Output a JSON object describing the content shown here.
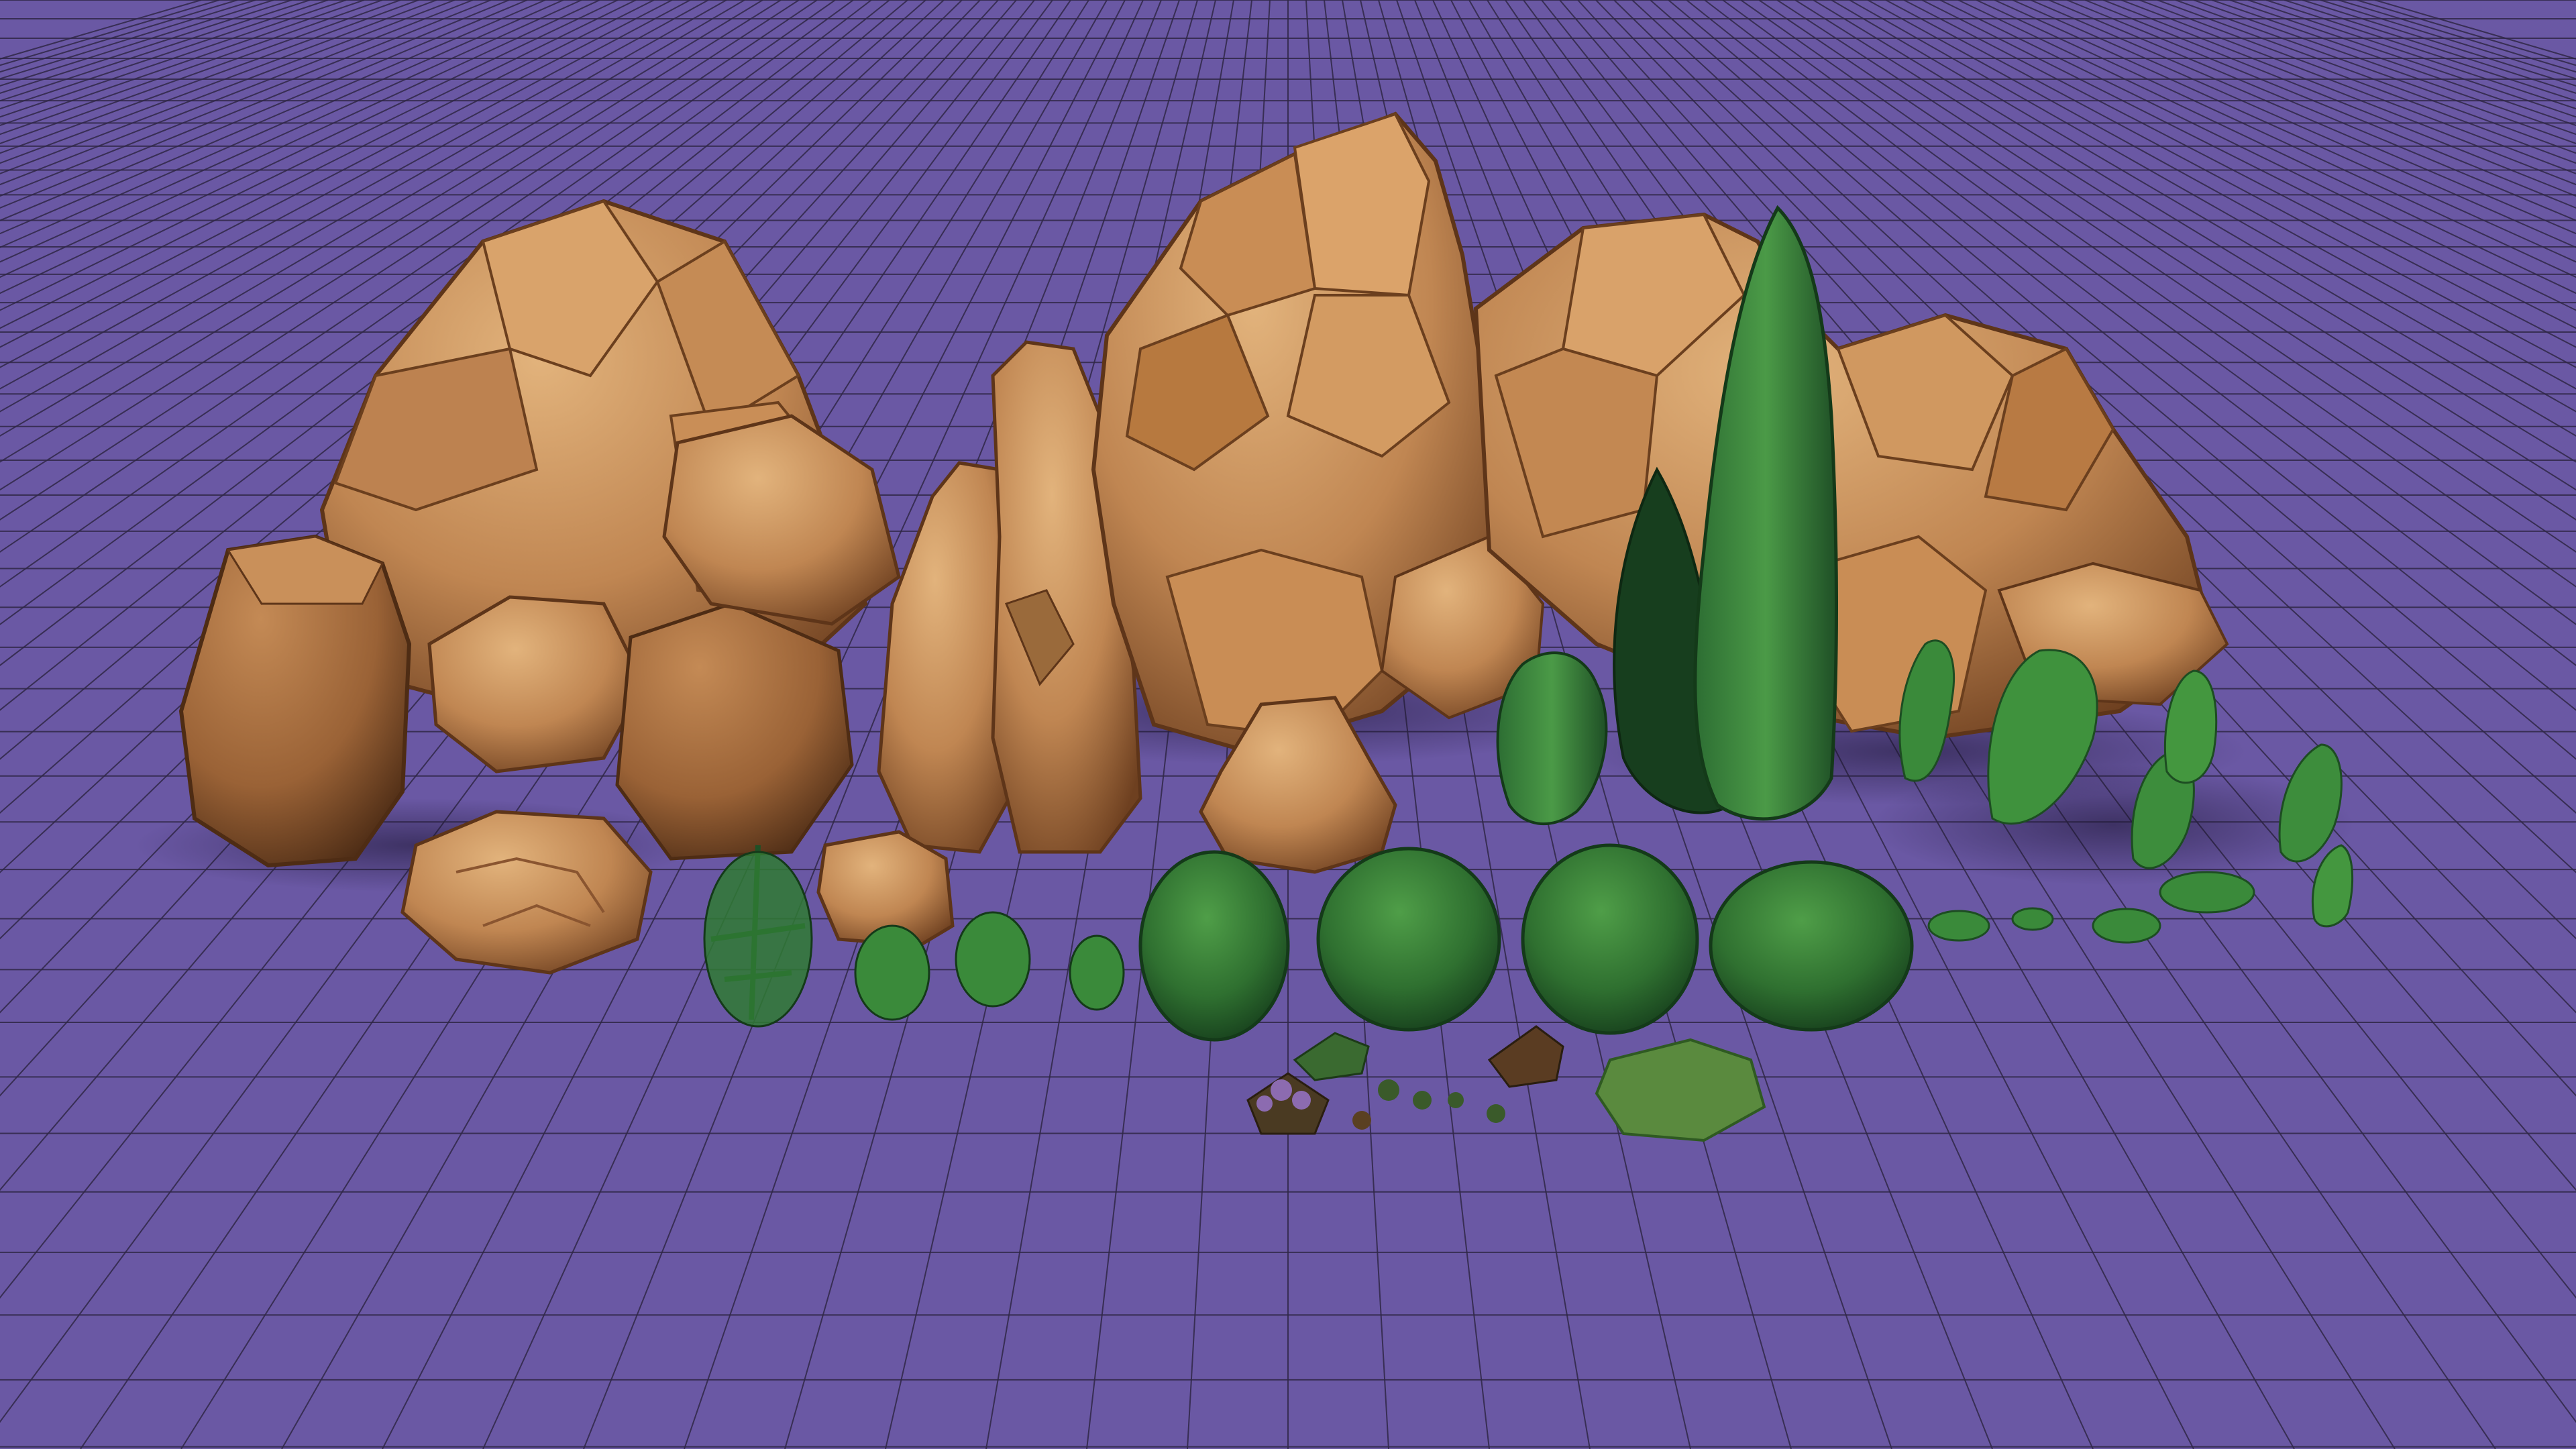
{
  "scene": {
    "kind": "3d-viewport-asset-showcase",
    "floor": {
      "color": "#6a58a4",
      "grid_line_color": "#2f2747",
      "grid": true
    },
    "palette": {
      "rock_light": "#d6a36c",
      "rock_mid": "#b67a45",
      "rock_dark": "#7c4b28",
      "rock_shadow": "#4a2c18",
      "foliage_light": "#4fa24c",
      "foliage_mid": "#2f7a34",
      "foliage_dark": "#194a22",
      "flower_purple": "#8c6bb0"
    },
    "assets": {
      "large_rocks": [
        {
          "id": "rock-cluster-left",
          "type": "rock-cluster"
        },
        {
          "id": "rock-cluster-center",
          "type": "rock-cluster"
        },
        {
          "id": "rock-cluster-right",
          "type": "rock-cluster"
        }
      ],
      "small_rocks": [
        {
          "id": "rock-pillar-left",
          "type": "rock"
        },
        {
          "id": "rock-pillar-center",
          "type": "rock"
        },
        {
          "id": "rock-flat-boulder",
          "type": "rock"
        },
        {
          "id": "rock-small-cube",
          "type": "rock"
        },
        {
          "id": "rock-small-mound",
          "type": "rock"
        }
      ],
      "trees": [
        {
          "id": "cypress-tall",
          "type": "tree"
        },
        {
          "id": "cypress-dark",
          "type": "tree"
        },
        {
          "id": "shrub-medium",
          "type": "shrub"
        }
      ],
      "bushes": [
        {
          "id": "bush-1",
          "type": "bush"
        },
        {
          "id": "bush-2",
          "type": "bush"
        },
        {
          "id": "bush-3",
          "type": "bush"
        },
        {
          "id": "bush-4",
          "type": "bush"
        }
      ],
      "small_plants": [
        {
          "id": "sapling-1",
          "type": "sapling"
        },
        {
          "id": "sapling-2",
          "type": "sapling"
        },
        {
          "id": "sapling-3",
          "type": "sapling"
        },
        {
          "id": "sapling-4",
          "type": "sapling"
        },
        {
          "id": "vine-1",
          "type": "vine"
        },
        {
          "id": "vine-2",
          "type": "vine"
        },
        {
          "id": "vine-3",
          "type": "vine"
        },
        {
          "id": "vine-4",
          "type": "vine"
        },
        {
          "id": "vine-5",
          "type": "vine"
        }
      ],
      "ground_cover": [
        {
          "id": "flower-purple",
          "type": "flower"
        },
        {
          "id": "fern-small-1",
          "type": "fern"
        },
        {
          "id": "fern-small-2",
          "type": "fern"
        },
        {
          "id": "grass-patch",
          "type": "grass"
        }
      ]
    }
  }
}
